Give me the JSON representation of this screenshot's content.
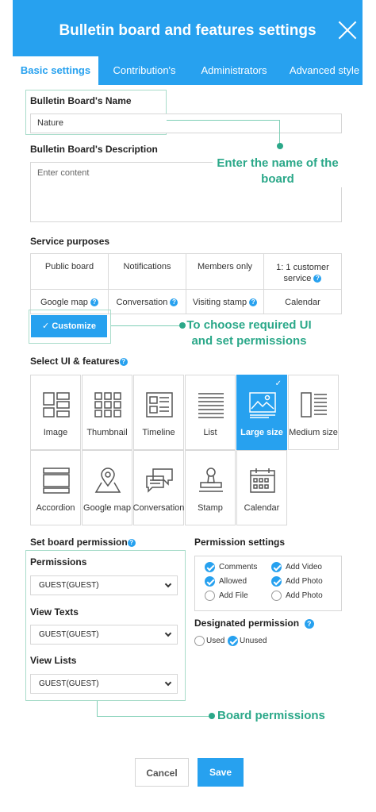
{
  "header": {
    "title": "Bulletin board and features settings"
  },
  "tabs": [
    {
      "label": "Basic settings",
      "active": true
    },
    {
      "label": "Contribution's"
    },
    {
      "label": "Administrators"
    },
    {
      "label": "Advanced style"
    }
  ],
  "board_name": {
    "label": "Bulletin Board's Name",
    "value": "Nature"
  },
  "board_description": {
    "label": "Bulletin Board's Description",
    "placeholder": "Enter content"
  },
  "callouts": {
    "name": "Enter the name of the board",
    "customize": "To choose required UI and set permissions",
    "permissions": "Board permissions"
  },
  "service_purposes": {
    "label": "Service purposes",
    "items": [
      "Public board",
      "Notifications",
      "Members only",
      "1: 1 customer service",
      "Google map",
      "Conversation",
      "Visiting stamp",
      "Calendar"
    ]
  },
  "customize_button": "Customize",
  "ui_features": {
    "label": "Select UI & features",
    "items": [
      {
        "label": "Image",
        "icon": "image-layout-icon"
      },
      {
        "label": "Thumbnail",
        "icon": "thumbnail-grid-icon"
      },
      {
        "label": "Timeline",
        "icon": "timeline-icon"
      },
      {
        "label": "List",
        "icon": "list-icon"
      },
      {
        "label": "Large size",
        "icon": "large-image-icon",
        "selected": true
      },
      {
        "label": "Medium size",
        "icon": "medium-image-icon"
      },
      {
        "label": "Accordion",
        "icon": "accordion-icon"
      },
      {
        "label": "Google map",
        "icon": "map-pin-icon"
      },
      {
        "label": "Conversation",
        "icon": "chat-bubbles-icon"
      },
      {
        "label": "Stamp",
        "icon": "stamp-icon"
      },
      {
        "label": "Calendar",
        "icon": "calendar-icon"
      }
    ]
  },
  "board_permission": {
    "label": "Set board permission",
    "permissions": {
      "label": "Permissions",
      "value": "GUEST(GUEST)"
    },
    "view_texts": {
      "label": "View Texts",
      "value": "GUEST(GUEST)"
    },
    "view_lists": {
      "label": "View Lists",
      "value": "GUEST(GUEST)"
    }
  },
  "permission_settings": {
    "label": "Permission settings",
    "options": [
      {
        "label": "Comments",
        "checked": true
      },
      {
        "label": "Add Video",
        "checked": true
      },
      {
        "label": "Allowed",
        "checked": true
      },
      {
        "label": "Add Photo",
        "checked": true
      },
      {
        "label": "Add File",
        "checked": false
      },
      {
        "label": "Add Photo",
        "checked": false
      }
    ]
  },
  "designated_permission": {
    "label": "Designated permission",
    "options": [
      {
        "label": "Used",
        "checked": false
      },
      {
        "label": "Unused",
        "checked": true
      }
    ]
  },
  "buttons": {
    "cancel": "Cancel",
    "save": "Save"
  },
  "colors": {
    "accent": "#27a1ef",
    "callout": "#2ba889"
  }
}
